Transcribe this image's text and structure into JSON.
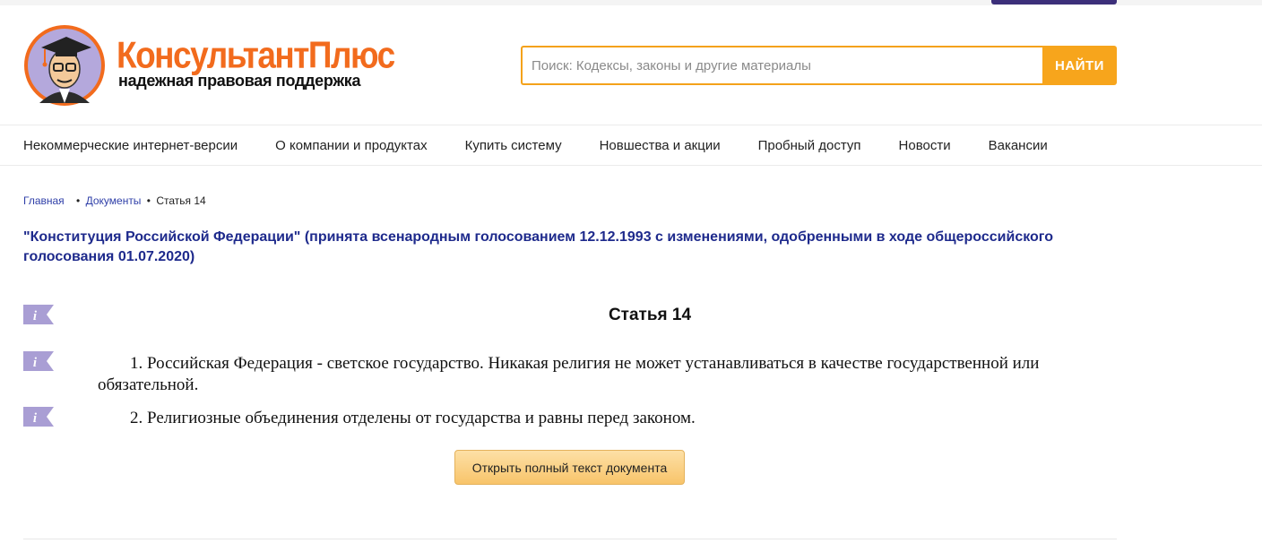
{
  "colors": {
    "brand_orange": "#f26b1d",
    "search_accent": "#f7a51c",
    "title_blue": "#1e2a8c",
    "link_blue": "#2f3fa8",
    "info_icon": "#a99ed4",
    "top_accent": "#3c2f7a"
  },
  "header": {
    "logo_title": "КонсультантПлюс",
    "logo_tagline": "надежная правовая поддержка",
    "logo_icon": "professor-mascot-icon"
  },
  "search": {
    "placeholder": "Поиск: Кодексы, законы и другие материалы",
    "button_label": "НАЙТИ"
  },
  "nav": {
    "items": [
      "Некоммерческие интернет-версии",
      "О компании и продуктах",
      "Купить систему",
      "Новшества и акции",
      "Пробный доступ",
      "Новости",
      "Вакансии"
    ]
  },
  "breadcrumb": {
    "home": "Главная",
    "documents": "Документы",
    "current": "Статья 14",
    "separator": "•"
  },
  "document": {
    "title": "\"Конституция Российской Федерации\" (принята всенародным голосованием 12.12.1993 с изменениями, одобренными в ходе общероссийского голосования 01.07.2020)",
    "article_title": "Статья 14",
    "paragraphs": [
      "1. Российская Федерация - светское государство. Никакая религия не может устанавливаться в качестве государственной или обязательной.",
      "2. Религиозные объединения отделены от государства и равны перед законом."
    ],
    "info_icon": "info-icon",
    "info_icon_glyph": "i"
  },
  "actions": {
    "open_full_text": "Открыть полный текст документа"
  }
}
